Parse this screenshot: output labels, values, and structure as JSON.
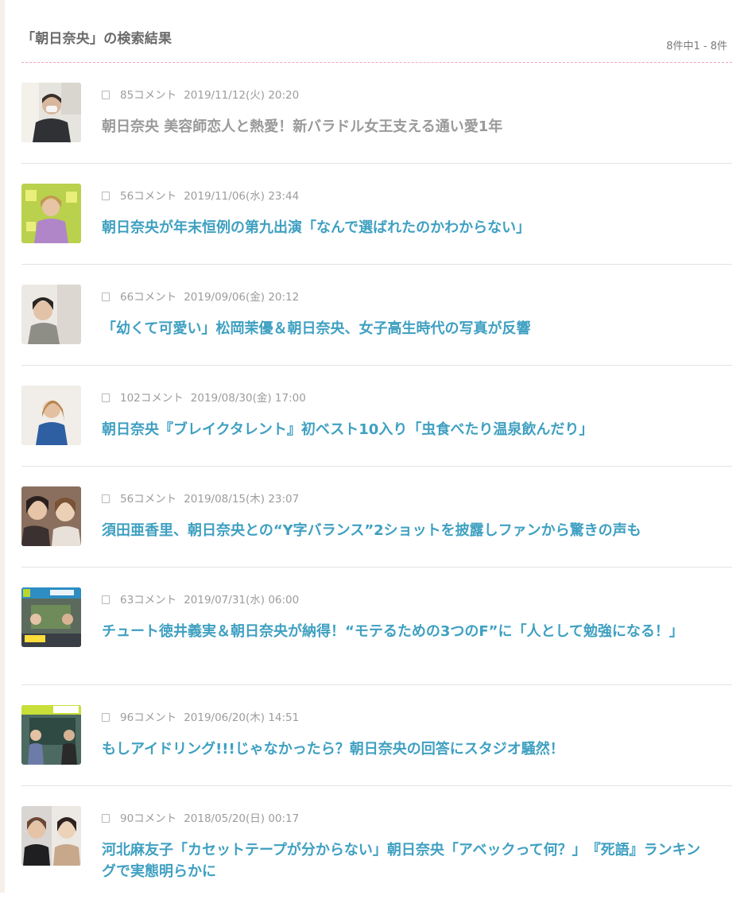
{
  "search": {
    "title": "「朝日奈央」の検索結果",
    "count": "8件中1 - 8件"
  },
  "colors": {
    "link": "#3fa0c1",
    "visited": "#9a9a9a",
    "meta": "#9c9c9c",
    "divider_dashed": "#f3a7b7"
  },
  "items": [
    {
      "comments": "85コメント",
      "date": "2019/11/12(火) 20:20",
      "headline": "朝日奈央 美容師恋人と熱愛！新バラドル女王支える通い愛1年",
      "visited": true,
      "icon": "comment-icon"
    },
    {
      "comments": "56コメント",
      "date": "2019/11/06(水) 23:44",
      "headline": "朝日奈央が年末恒例の第九出演「なんで選ばれたのかわからない」",
      "visited": false,
      "icon": "comment-icon"
    },
    {
      "comments": "66コメント",
      "date": "2019/09/06(金) 20:12",
      "headline": "「幼くて可愛い」松岡茉優＆朝日奈央、女子高生時代の写真が反響",
      "visited": false,
      "icon": "comment-icon"
    },
    {
      "comments": "102コメント",
      "date": "2019/08/30(金) 17:00",
      "headline": "朝日奈央『ブレイクタレント』初ベスト10入り「虫食べたり温泉飲んだり」",
      "visited": false,
      "icon": "comment-icon"
    },
    {
      "comments": "56コメント",
      "date": "2019/08/15(木) 23:07",
      "headline": "須田亜香里、朝日奈央との“Y字バランス”2ショットを披露しファンから驚きの声も",
      "visited": false,
      "icon": "comment-icon"
    },
    {
      "comments": "63コメント",
      "date": "2019/07/31(水) 06:00",
      "headline": "チュート徳井義実＆朝日奈央が納得！“モテるための3つのF”に「人として勉強になる！」",
      "visited": false,
      "icon": "comment-icon"
    },
    {
      "comments": "96コメント",
      "date": "2019/06/20(木) 14:51",
      "headline": "もしアイドリング!!!じゃなかったら？朝日奈央の回答にスタジオ騒然！",
      "visited": false,
      "icon": "comment-icon"
    },
    {
      "comments": "90コメント",
      "date": "2018/05/20(日) 00:17",
      "headline": "河北麻友子「カセットテープが分からない」朝日奈央「アベックって何？」　『死語』ランキングで実態明らかに",
      "visited": false,
      "icon": "comment-icon"
    }
  ]
}
